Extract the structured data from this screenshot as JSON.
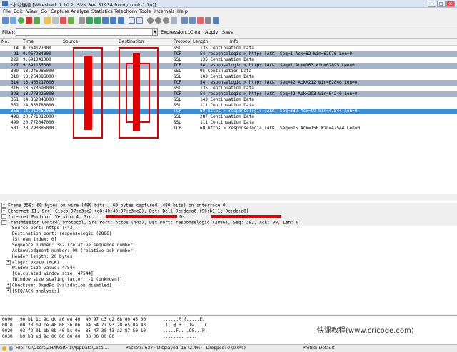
{
  "window": {
    "title": "*本地连接   [Wireshark 1.10.2  (SVN Rev 51934 from /trunk-1.10)]"
  },
  "menu": [
    "File",
    "Edit",
    "View",
    "Go",
    "Capture",
    "Analyze",
    "Statistics",
    "Telephony",
    "Tools",
    "Internals",
    "Help"
  ],
  "filter": {
    "label": "Filter:",
    "value": "",
    "buttons": [
      "Expression...",
      "Clear",
      "Apply",
      "Save"
    ]
  },
  "packet_list": {
    "columns": [
      "No.",
      "Time",
      "Source",
      "Destination",
      "Protocol",
      "Length",
      "Info"
    ],
    "rows": [
      {
        "no": "14",
        "time": "0.764127000",
        "proto": "SSL",
        "info": "135 Continuation Data",
        "bg": "#ffffff"
      },
      {
        "no": "21",
        "time": "0.967984000",
        "proto": "TCP",
        "info": "54 responselogic > https [ACK] Seq=1 Ack=82 Win=62976 Len=0",
        "bg": "#a6b4c8"
      },
      {
        "no": "222",
        "time": "9.691341000",
        "proto": "SSL",
        "info": "135 Continuation Data",
        "bg": "#ffffff"
      },
      {
        "no": "227",
        "time": "9.891155000",
        "proto": "TCP",
        "info": "54 responselogic > https [ACK] Seq=1 Ack=163 Win=62895 Len=0",
        "bg": "#a6b4c8"
      },
      {
        "no": "309",
        "time": "13.245986000",
        "proto": "SSL",
        "info": "95 Continuation Data",
        "bg": "#ffffff"
      },
      {
        "no": "310",
        "time": "13.264086000",
        "proto": "SSL",
        "info": "103 Continuation Data",
        "bg": "#ffffff"
      },
      {
        "no": "314",
        "time": "13.463217000",
        "proto": "TCP",
        "info": "54 responselogic > https [ACK] Seq=42 Ack=212 Win=62846 Len=0",
        "bg": "#a6b4c8"
      },
      {
        "no": "316",
        "time": "13.573698000",
        "proto": "SSL",
        "info": "135 Continuation Data",
        "bg": "#ffffff"
      },
      {
        "no": "323",
        "time": "13.773225000",
        "proto": "TCP",
        "info": "54 responselogic > https [ACK] Seq=42 Ack=293 Win=64240 Len=0",
        "bg": "#a6b4c8"
      },
      {
        "no": "351",
        "time": "14.862843000",
        "proto": "SSL",
        "info": "143 Continuation Data",
        "bg": "#ffffff"
      },
      {
        "no": "352",
        "time": "14.863783000",
        "proto": "SSL",
        "info": "111 Continuation Data",
        "bg": "#ffffff"
      },
      {
        "no": "358",
        "time": "14.919469000",
        "proto": "TCP",
        "info": "60 https > responselogic [ACK] Seq=382 Ack=99 Win=47544 Len=0",
        "bg": "#3f8fd4",
        "selected": true
      },
      {
        "no": "498",
        "time": "20.771012000",
        "proto": "SSL",
        "info": "287 Continuation Data",
        "bg": "#ffffff"
      },
      {
        "no": "499",
        "time": "20.772047000",
        "proto": "SSL",
        "info": "111 Continuation Data",
        "bg": "#ffffff"
      },
      {
        "no": "501",
        "time": "20.790385000",
        "proto": "TCP",
        "info": "60 https > responselogic [ACK] Seq=615 Ack=156 Win=47544 Len=0",
        "bg": "#ffffff"
      }
    ]
  },
  "details": [
    {
      "text": "Frame 358: 60 bytes on wire (480 bits), 60 bytes captured (480 bits) on interface 0",
      "level": 0,
      "exp": "+"
    },
    {
      "text": "Ethernet II, Src: Cisco_97:c3:c2 (e8:40:40:97:c3:c2), Dst: Dell_9c:dc:a6 (90:b1:1c:9c:dc:a6)",
      "level": 0,
      "exp": "+"
    },
    {
      "text": "Internet Protocol Version 4, Src:",
      "text2": ", Dst:",
      "level": 0,
      "exp": "+",
      "redacted": true
    },
    {
      "text": "Transmission Control Protocol, Src Port: https (443), Dst Port: responselogic (2886), Seq: 382, Ack: 99, Len: 0",
      "level": 0,
      "exp": "-"
    },
    {
      "text": "Source port: https (443)",
      "level": 1
    },
    {
      "text": "Destination port: responselogic (2886)",
      "level": 1
    },
    {
      "text": "[Stream index: 0]",
      "level": 1
    },
    {
      "text": "Sequence number: 382    (relative sequence number)",
      "level": 1
    },
    {
      "text": "Acknowledgment number: 99    (relative ack number)",
      "level": 1
    },
    {
      "text": "Header length: 20 bytes",
      "level": 1
    },
    {
      "text": "Flags: 0x010 (ACK)",
      "level": 1,
      "exp": "+"
    },
    {
      "text": "Window size value: 47544",
      "level": 1
    },
    {
      "text": "[Calculated window size: 47544]",
      "level": 1
    },
    {
      "text": "[Window size scaling factor: -1 (unknown)]",
      "level": 1
    },
    {
      "text": "Checksum: 0xed9c [validation disabled]",
      "level": 1,
      "exp": "+"
    },
    {
      "text": "[SEQ/ACK analysis]",
      "level": 1,
      "exp": "+"
    }
  ],
  "hex": [
    {
      "off": "0000",
      "bytes": "90 b1 1c 9c dc a6 e8 40  40 97 c3 c2 08 00 45 00",
      "ascii": "......@ @.....E."
    },
    {
      "off": "0010",
      "bytes": "00 28 b9 ce 40 00 36 06  e4 54 77 93 20 e5 0a 43",
      "ascii": ".(..@.6. .Tw. ..C"
    },
    {
      "off": "0020",
      "bytes": "03 f2 01 bb 0b 46 bc 0e  85 47 30 f3 a2 87 50 10",
      "ascii": ".....F.. .G0...P."
    },
    {
      "off": "0030",
      "bytes": "b9 b8 ed 9c 00 00 00 00  00 00 00 00",
      "ascii": "........ ...."
    }
  ],
  "watermark": "快课教程(www.cricode.com)",
  "status": {
    "file": "File: \"C:\\Users\\ZHANGR~1\\AppData\\Local...",
    "packets": "Packets: 637 · Displayed: 15 (2.4%) · Dropped: 0 (0.0%)",
    "profile": "Profile: Default"
  },
  "colors": {
    "tcp_row": "#a6b4c8",
    "selected_row": "#3f8fd4",
    "redaction": "#e00000"
  }
}
